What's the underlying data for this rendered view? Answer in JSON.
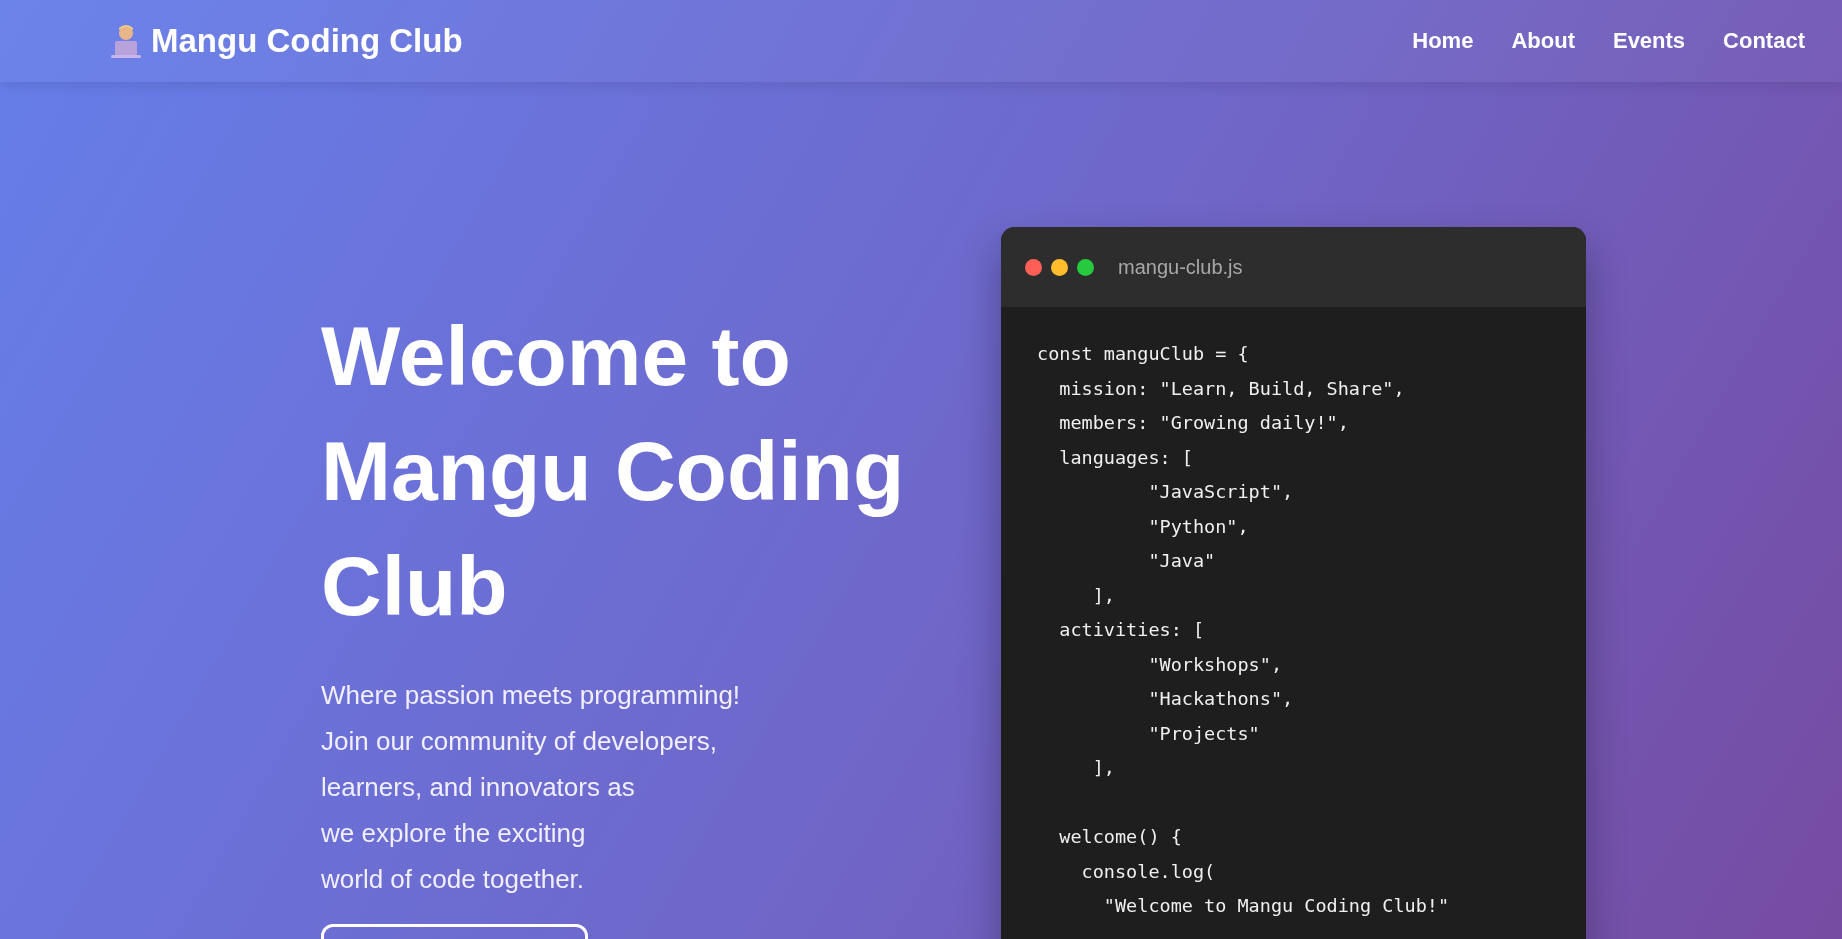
{
  "nav": {
    "brand": "Mangu Coding Club",
    "links": [
      "Home",
      "About",
      "Events",
      "Contact"
    ]
  },
  "hero": {
    "title_lines": [
      "Welcome to",
      "Mangu Coding",
      "Club"
    ],
    "description_lines": [
      "Where passion meets programming!",
      "Join our community of developers,",
      "learners, and innovators as",
      "we explore the exciting",
      "world of code together."
    ]
  },
  "code_window": {
    "filename": "mangu-club.js",
    "blocks": [
      [
        "const manguClub = {",
        "  mission: \"Learn, Build, Share\",",
        "  members: \"Growing daily!\",",
        "  languages: [",
        "          \"JavaScript\",",
        "          \"Python\",",
        "          \"Java\"",
        "     ],",
        "  activities: [",
        "          \"Workshops\",",
        "          \"Hackathons\",",
        "          \"Projects\"",
        "     ],"
      ],
      [
        "  welcome() {",
        "    console.log(",
        "      \"Welcome to Mangu Coding Club!\""
      ]
    ]
  }
}
